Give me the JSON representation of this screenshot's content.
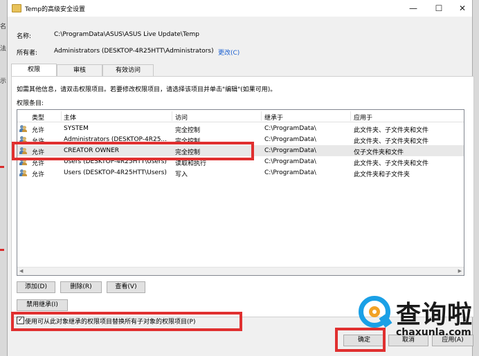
{
  "window": {
    "title": "Temp的高级安全设置",
    "controls": {
      "minimize": "—",
      "maximize": "☐",
      "close": "✕"
    }
  },
  "name_row": {
    "label": "名称:",
    "value": "C:\\ProgramData\\ASUS\\ASUS Live Update\\Temp"
  },
  "owner_row": {
    "label": "所有者:",
    "value": "Administrators (DESKTOP-4R25HTT\\Administrators)",
    "change_link": "更改(C)"
  },
  "tabs": [
    {
      "label": "权限",
      "active": true
    },
    {
      "label": "审核",
      "active": false
    },
    {
      "label": "有效访问",
      "active": false
    }
  ],
  "instructions": "如需其他信息，请双击权限项目。若要修改权限项目，请选择该项目并单击\"编辑\"(如果可用)。",
  "entries_label": "权限条目:",
  "table": {
    "columns": [
      "类型",
      "主体",
      "访问",
      "继承于",
      "应用于"
    ],
    "rows": [
      {
        "type": "允许",
        "principal": "SYSTEM",
        "access": "完全控制",
        "inherited": "C:\\ProgramData\\",
        "applies": "此文件夹、子文件夹和文件",
        "selected": false
      },
      {
        "type": "允许",
        "principal": "Administrators (DESKTOP-4R25...",
        "access": "完全控制",
        "inherited": "C:\\ProgramData\\",
        "applies": "此文件夹、子文件夹和文件",
        "selected": false
      },
      {
        "type": "允许",
        "principal": "CREATOR OWNER",
        "access": "完全控制",
        "inherited": "C:\\ProgramData\\",
        "applies": "仅子文件夹和文件",
        "selected": true
      },
      {
        "type": "允许",
        "principal": "Users (DESKTOP-4R25HTT\\Users)",
        "access": "读取和执行",
        "inherited": "C:\\ProgramData\\",
        "applies": "此文件夹、子文件夹和文件",
        "selected": false
      },
      {
        "type": "允许",
        "principal": "Users (DESKTOP-4R25HTT\\Users)",
        "access": "写入",
        "inherited": "C:\\ProgramData\\",
        "applies": "此文件夹和子文件夹",
        "selected": false
      }
    ]
  },
  "buttons": {
    "add": "添加(D)",
    "remove": "删除(R)",
    "view": "查看(V)",
    "disable_inheritance": "禁用继承(I)",
    "ok": "确定",
    "cancel": "取消",
    "apply": "应用(A)"
  },
  "replace_checkbox": {
    "label": "使用可从此对象继承的权限项目替换所有子对象的权限项目(P)",
    "checked": true
  },
  "watermark": {
    "brand": "查询啦",
    "domain": "chaxunla.com"
  },
  "colors": {
    "highlight": "#e03030",
    "link": "#1a5fd1",
    "watermark_blue": "#1aa0e6",
    "watermark_orange": "#f2a225"
  },
  "background_fragments": {
    "left_1": "名",
    "left_2": "法",
    "left_3": "示"
  }
}
